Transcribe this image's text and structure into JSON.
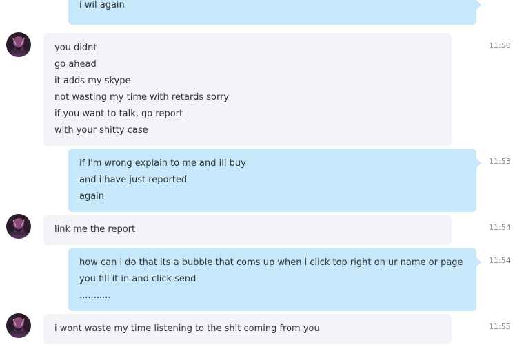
{
  "colors": {
    "incoming_bubble": "#f1f3f7",
    "outgoing_bubble": "#c7e7fa",
    "timestamp": "#7b8a98",
    "text": "#333333"
  },
  "contact": {
    "avatar_icon": "contact-avatar-icon"
  },
  "messages": [
    {
      "direction": "outgoing",
      "lines": [
        "i wil again"
      ],
      "time": ""
    },
    {
      "direction": "incoming",
      "lines": [
        "you didnt",
        "go ahead",
        "it adds my skype",
        "not wasting my time with retards sorry",
        "if you want to talk, go report",
        "with your shitty case"
      ],
      "time": "11:50"
    },
    {
      "direction": "outgoing",
      "lines": [
        "if I'm wrong explain to me and ill buy",
        "and i have just reported",
        "again"
      ],
      "time": "11:53"
    },
    {
      "direction": "incoming",
      "lines": [
        "link me the report"
      ],
      "time": "11:54"
    },
    {
      "direction": "outgoing",
      "lines": [
        "how can i do that its a bubble that coms up when i click top right on ur name or page",
        "you fill it in and click send",
        "..........."
      ],
      "time": "11:54"
    },
    {
      "direction": "incoming",
      "lines": [
        "i wont waste my time listening to the shit coming from you"
      ],
      "time": "11:55"
    }
  ]
}
